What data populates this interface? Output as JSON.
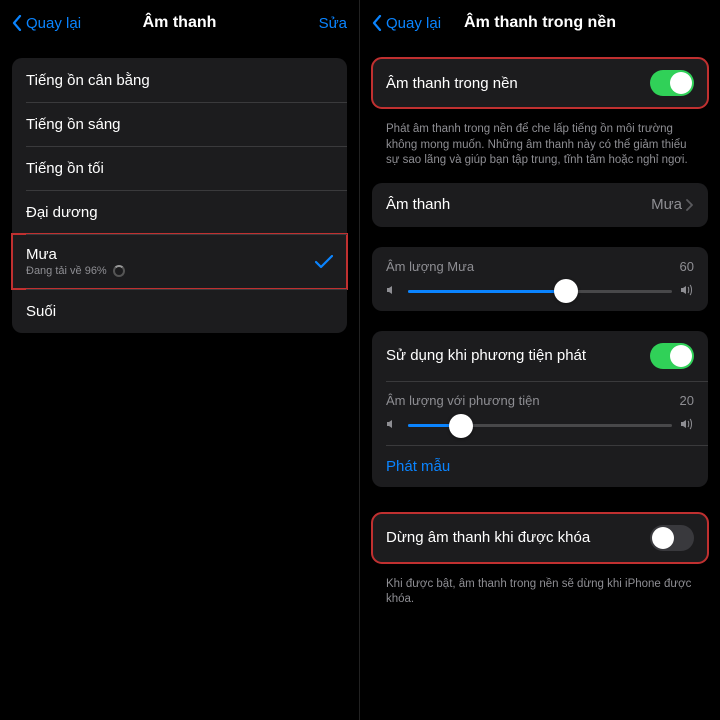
{
  "left": {
    "nav": {
      "back": "Quay lại",
      "title": "Âm thanh",
      "edit": "Sửa"
    },
    "sounds": [
      {
        "label": "Tiếng ồn cân bằng"
      },
      {
        "label": "Tiếng ồn sáng"
      },
      {
        "label": "Tiếng ồn tối"
      },
      {
        "label": "Đại dương"
      },
      {
        "label": "Mưa",
        "downloading": "Đang tải về 96%",
        "selected": true
      },
      {
        "label": "Suối"
      }
    ]
  },
  "right": {
    "nav": {
      "back": "Quay lại",
      "title": "Âm thanh trong nền"
    },
    "bg_toggle": {
      "label": "Âm thanh trong nền",
      "desc": "Phát âm thanh trong nền để che lấp tiếng ồn môi trường không mong muốn. Những âm thanh này có thể giảm thiểu sự sao lãng và giúp bạn tập trung, tĩnh tâm hoặc nghỉ ngơi."
    },
    "sound_select": {
      "label": "Âm thanh",
      "value": "Mưa"
    },
    "volume": {
      "label": "Âm lượng Mưa",
      "value": "60",
      "percent": 60
    },
    "media": {
      "label": "Sử dụng khi phương tiện phát",
      "vol_label": "Âm lượng với phương tiện",
      "vol_value": "20",
      "vol_percent": 20,
      "sample": "Phát mẫu"
    },
    "lock": {
      "label": "Dừng âm thanh khi được khóa",
      "desc": "Khi được bật, âm thanh trong nền sẽ dừng khi iPhone được khóa."
    }
  }
}
